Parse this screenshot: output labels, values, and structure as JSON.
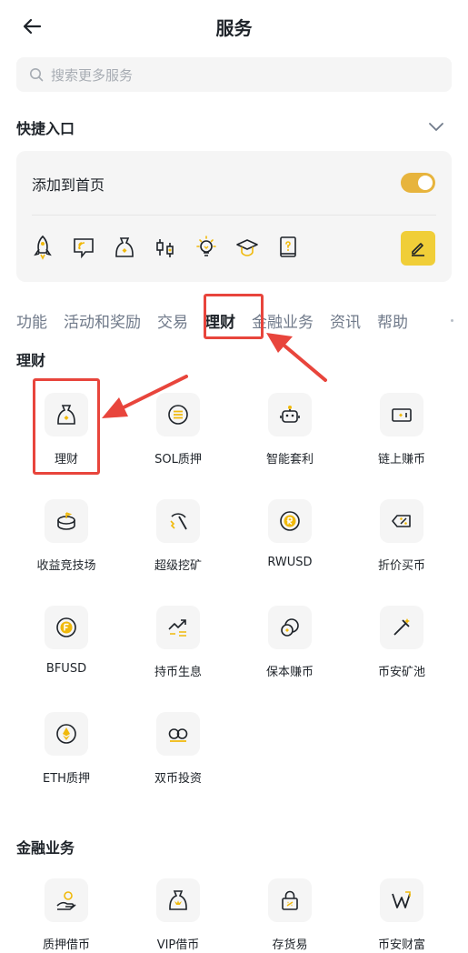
{
  "header": {
    "title": "服务",
    "back_icon": "arrow-left-icon"
  },
  "search": {
    "placeholder": "搜索更多服务"
  },
  "quick_entry": {
    "title": "快捷入口",
    "add_to_home_label": "添加到首页",
    "toggle_on": true,
    "icons": [
      "rocket-icon",
      "chat-bubble-icon",
      "money-bag-icon",
      "candlestick-icon",
      "lightbulb-icon",
      "graduation-cap-icon",
      "book-question-icon"
    ],
    "edit_icon": "pencil-icon"
  },
  "tabs": [
    "功能",
    "活动和奖励",
    "交易",
    "理财",
    "金融业务",
    "资讯",
    "帮助"
  ],
  "active_tab": "理财",
  "sections": [
    {
      "title": "理财",
      "items": [
        {
          "label": "理财",
          "icon": "money-bag-icon"
        },
        {
          "label": "SOL质押",
          "icon": "sol-coin-icon"
        },
        {
          "label": "智能套利",
          "icon": "robot-icon"
        },
        {
          "label": "链上赚币",
          "icon": "chain-wallet-icon"
        },
        {
          "label": "收益竞技场",
          "icon": "arena-icon"
        },
        {
          "label": "超级挖矿",
          "icon": "pickaxe-icon"
        },
        {
          "label": "RWUSD",
          "icon": "rwusd-coin-icon"
        },
        {
          "label": "折价买币",
          "icon": "discount-tag-icon"
        },
        {
          "label": "BFUSD",
          "icon": "bfusd-coin-icon"
        },
        {
          "label": "持币生息",
          "icon": "trend-up-icon"
        },
        {
          "label": "保本赚币",
          "icon": "coins-icon"
        },
        {
          "label": "币安矿池",
          "icon": "mining-pool-icon"
        },
        {
          "label": "ETH质押",
          "icon": "eth-coin-icon"
        },
        {
          "label": "双币投资",
          "icon": "dual-coin-icon"
        }
      ]
    },
    {
      "title": "金融业务",
      "items": [
        {
          "label": "质押借币",
          "icon": "hand-coin-icon"
        },
        {
          "label": "VIP借币",
          "icon": "vip-bag-icon"
        },
        {
          "label": "存货易",
          "icon": "lock-icon"
        },
        {
          "label": "币安财富",
          "icon": "wealth-logo-icon"
        }
      ]
    }
  ],
  "colors": {
    "accent": "#F0B90B",
    "highlight": "#E8453C",
    "text": "#1E2329",
    "muted": "#707A8A"
  }
}
